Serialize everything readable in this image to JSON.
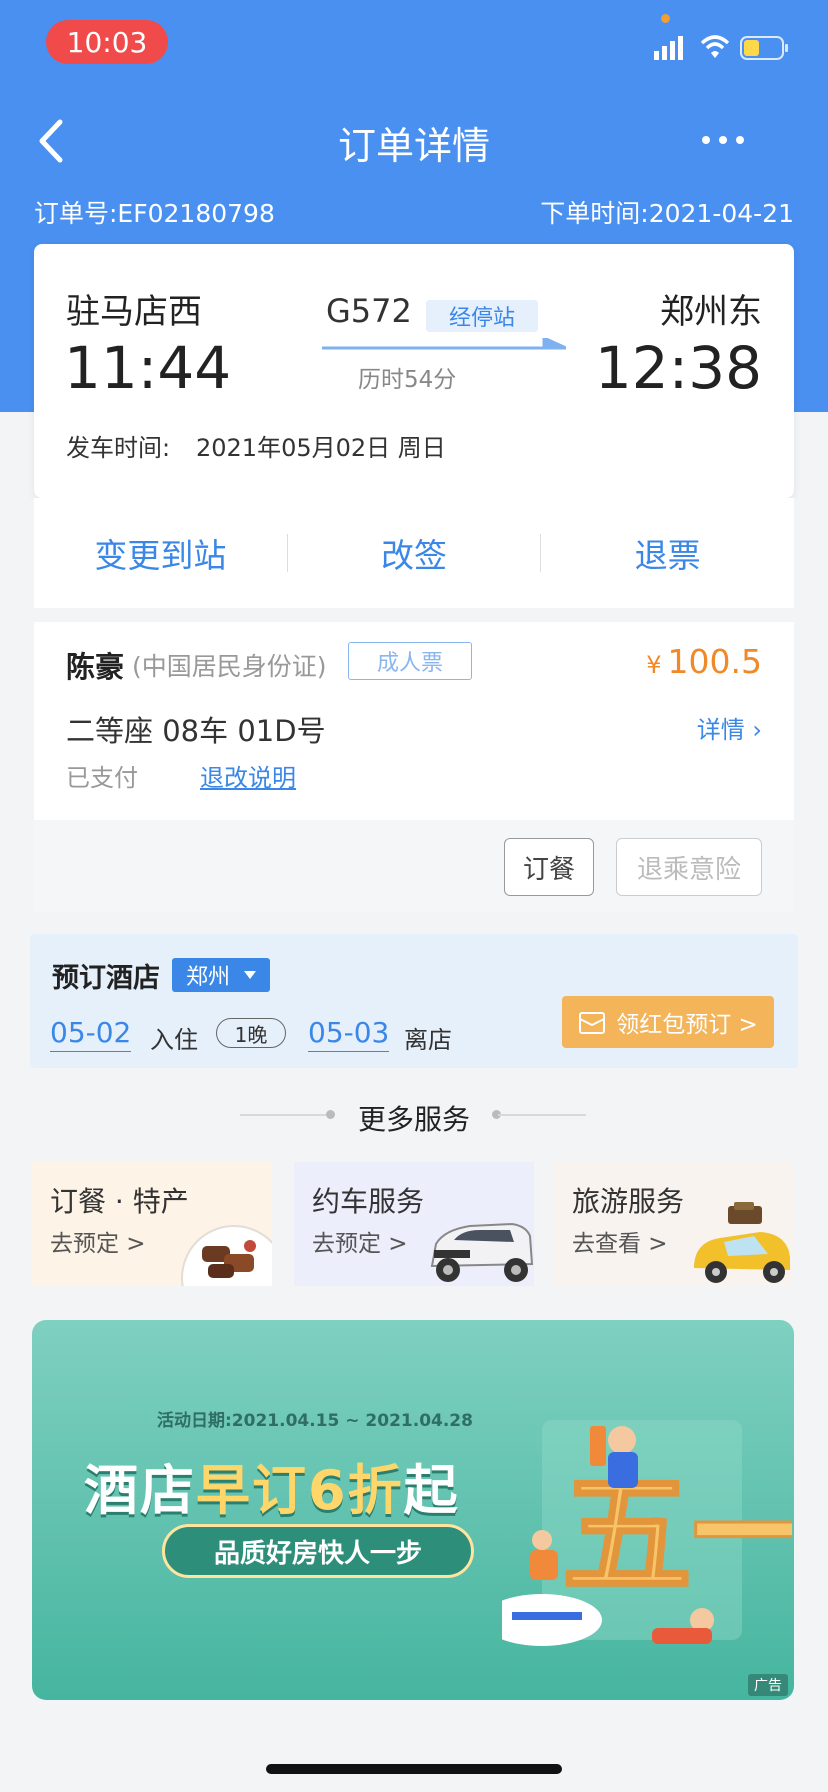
{
  "status_bar": {
    "time": "10:03"
  },
  "nav": {
    "title": "订单详情"
  },
  "order": {
    "number": "订单号:EF02180798",
    "time": "下单时间:2021-04-21"
  },
  "ticket": {
    "from_station": "驻马店西",
    "from_time": "11:44",
    "to_station": "郑州东",
    "to_time": "12:38",
    "train_no": "G572",
    "via_label": "经停站",
    "duration": "历时54分",
    "depart_label": "发车时间:",
    "depart_value": "2021年05月02日 周日"
  },
  "actions": [
    {
      "label": "变更到站"
    },
    {
      "label": "改签"
    },
    {
      "label": "退票"
    }
  ],
  "passenger": {
    "name": "陈豪",
    "id_type": "(中国居民身份证)",
    "ticket_type": "成人票",
    "currency": "¥",
    "price": "100.5",
    "seat": "二等座 08车 01D号",
    "detail_label": "详情 ›",
    "status": "已支付",
    "rule_link": "退改说明"
  },
  "extras": {
    "meal": "订餐",
    "insurance": "退乘意险"
  },
  "hotel": {
    "title": "预订酒店",
    "city": "郑州",
    "check_in_date": "05-02",
    "check_in_label": "入住",
    "nights": "1晚",
    "check_out_date": "05-03",
    "check_out_label": "离店",
    "book_label": "领红包预订 >"
  },
  "more_services": {
    "title": "更多服务",
    "items": [
      {
        "title": "订餐 · 特产",
        "sub": "去预定 >"
      },
      {
        "title": "约车服务",
        "sub": "去预定 >"
      },
      {
        "title": "旅游服务",
        "sub": "去查看 >"
      }
    ]
  },
  "banner": {
    "period": "活动日期:2021.04.15 ~ 2021.04.28",
    "headline_a": "酒店",
    "headline_b": "早订6折",
    "headline_c": "起",
    "tagline": "品质好房快人一步",
    "art_text": "五一",
    "ad_label": "广告"
  },
  "colors": {
    "header_blue": "#4a90f0",
    "link_blue": "#3a87e8",
    "price_orange": "#f08a28",
    "time_red": "#f04a4a",
    "banner_green": "#46b59f"
  }
}
